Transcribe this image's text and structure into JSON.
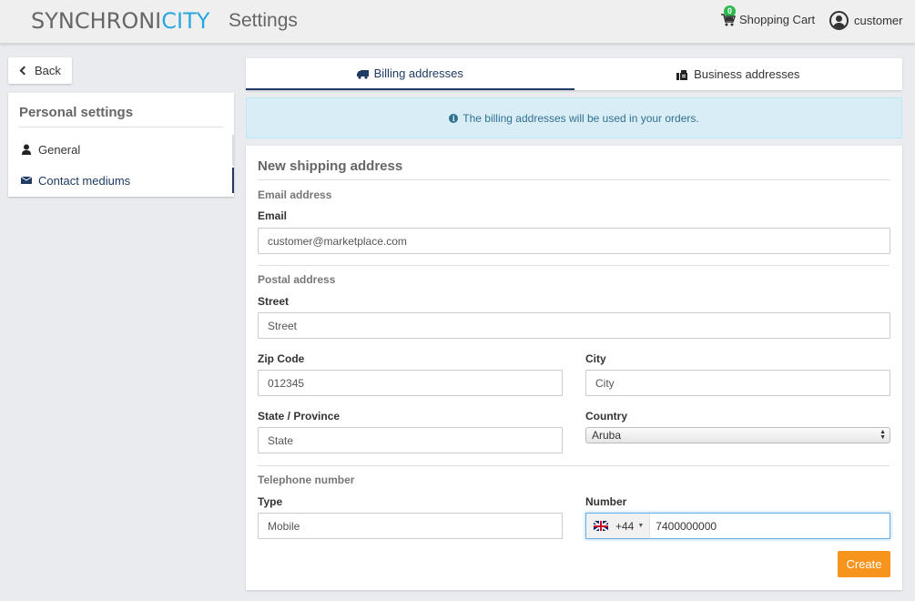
{
  "header": {
    "logo_part1": "SYNCHRONI",
    "logo_part2": "CITY",
    "title": "Settings",
    "cart_count": "0",
    "cart_label": "Shopping Cart",
    "user_label": "customer"
  },
  "sidebar": {
    "back_label": "Back",
    "title": "Personal settings",
    "items": [
      {
        "label": "General",
        "icon": "user-icon"
      },
      {
        "label": "Contact mediums",
        "icon": "envelope-icon"
      }
    ]
  },
  "tabs": [
    {
      "label": "Billing addresses",
      "icon": "truck-icon",
      "active": true
    },
    {
      "label": "Business addresses",
      "icon": "fax-icon",
      "active": false
    }
  ],
  "info": {
    "text": "The billing addresses will be used in your orders."
  },
  "form": {
    "title": "New shipping address",
    "email_section": "Email address",
    "email_label": "Email",
    "email_value": "customer@marketplace.com",
    "postal_section": "Postal address",
    "street_label": "Street",
    "street_placeholder": "Street",
    "zip_label": "Zip Code",
    "zip_value": "012345",
    "city_label": "City",
    "city_placeholder": "City",
    "state_label": "State / Province",
    "state_placeholder": "State",
    "country_label": "Country",
    "country_value": "Aruba",
    "phone_section": "Telephone number",
    "type_label": "Type",
    "type_value": "Mobile",
    "number_label": "Number",
    "dial_code": "+44",
    "number_value": "7400000000",
    "create_label": "Create"
  },
  "colors": {
    "accent_blue": "#29a8df",
    "navy": "#1f3b63",
    "create_orange": "#f7941d",
    "info_bg": "#d9edf7",
    "badge_green": "#2cba4f"
  }
}
